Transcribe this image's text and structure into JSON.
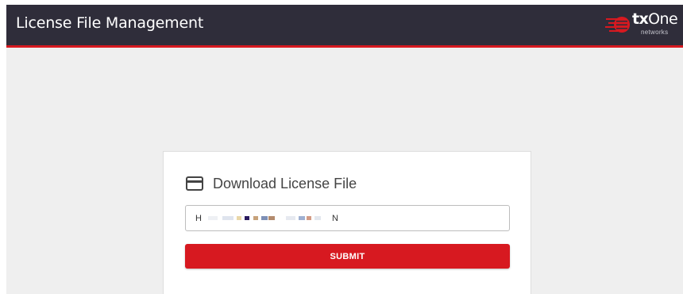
{
  "header": {
    "title": "License File Management",
    "logo": {
      "brand_bold": "tx",
      "brand_regular": "One",
      "subtitle": "networks"
    }
  },
  "card": {
    "title": "Download License File",
    "icon": "credit-card-icon"
  },
  "license_input": {
    "value_start": "H",
    "value_end": "N",
    "masked": true
  },
  "submit_button": {
    "label": "SUBMIT"
  },
  "colors": {
    "header_bg": "#2f2d3a",
    "accent": "#d71920",
    "page_bg": "#efefef"
  }
}
